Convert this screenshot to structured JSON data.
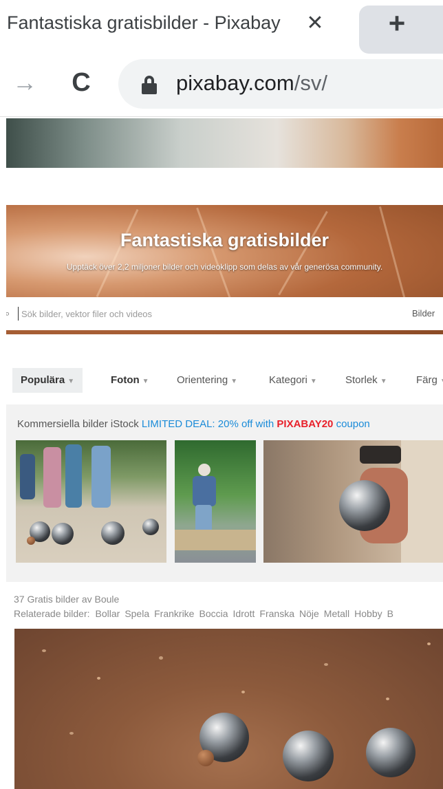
{
  "browser": {
    "tab_title": "Fantastiska gratisbilder - Pixabay",
    "tab_close": "✕",
    "new_tab": "+",
    "forward": "→",
    "reload": "C",
    "url_host": "pixabay.com",
    "url_path": "/sv/"
  },
  "hero": {
    "title": "Fantastiska gratisbilder",
    "subtitle": "Upptäck över 2,2 miljoner bilder och videoklipp som delas av vår generösa community.",
    "search_placeholder": "Sök bilder, vektor filer och videos",
    "search_type": "Bilder"
  },
  "filters": {
    "popular": "Populära",
    "photos": "Foton",
    "orientation": "Orientering",
    "category": "Kategori",
    "size": "Storlek",
    "color": "Färg"
  },
  "istock": {
    "prefix": "Kommersiella bilder iStock",
    "deal": "LIMITED DEAL: 20% off with",
    "code": "PIXABAY20",
    "suffix": "coupon"
  },
  "results": {
    "count": "37 Gratis bilder av Boule",
    "related_label": "Relaterade bilder:",
    "related": [
      "Bollar",
      "Spela",
      "Frankrike",
      "Boccia",
      "Idrott",
      "Franska",
      "Nöje",
      "Metall",
      "Hobby",
      "B"
    ]
  }
}
